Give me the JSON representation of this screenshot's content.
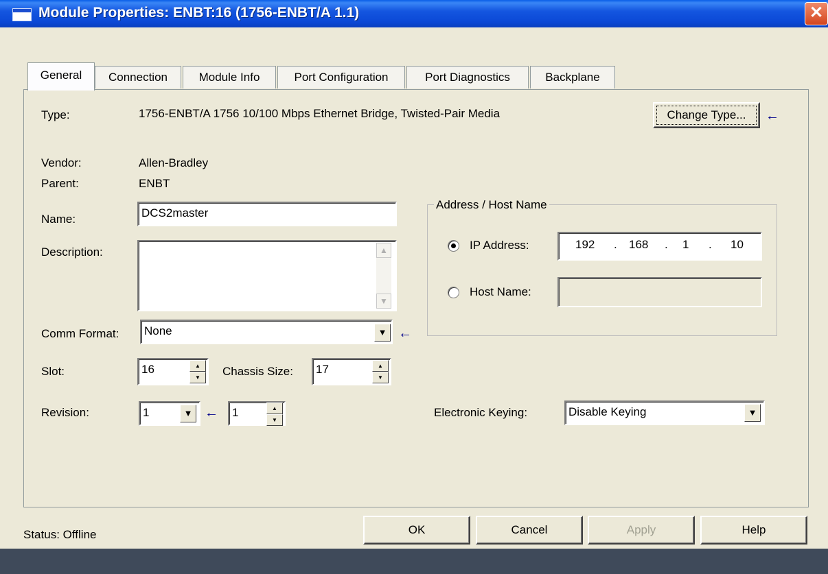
{
  "window": {
    "title": "Module Properties: ENBT:16 (1756-ENBT/A 1.1)",
    "close_glyph": "✕"
  },
  "tabs": [
    "General",
    "Connection",
    "Module Info",
    "Port Configuration",
    "Port Diagnostics",
    "Backplane"
  ],
  "active_tab": "General",
  "general": {
    "type_label": "Type:",
    "type_value": "1756-ENBT/A 1756 10/100 Mbps Ethernet Bridge, Twisted-Pair Media",
    "change_type_label": "Change Type...",
    "vendor_label": "Vendor:",
    "vendor_value": "Allen-Bradley",
    "parent_label": "Parent:",
    "parent_value": "ENBT",
    "name_label": "Name:",
    "name_value": "DCS2master",
    "description_label": "Description:",
    "description_value": "",
    "comm_format_label": "Comm Format:",
    "comm_format_value": "None",
    "slot_label": "Slot:",
    "slot_value": "16",
    "chassis_size_label": "Chassis Size:",
    "chassis_size_value": "17",
    "revision_label": "Revision:",
    "revision_major": "1",
    "revision_minor": "1",
    "address_group_label": "Address / Host Name",
    "ip_address_label": "IP Address:",
    "ip_octets": [
      "192",
      "168",
      "1",
      "10"
    ],
    "ip_address_selected": true,
    "host_name_label": "Host Name:",
    "host_name_value": "",
    "electronic_keying_label": "Electronic Keying:",
    "electronic_keying_value": "Disable Keying"
  },
  "status": {
    "label": "Status:",
    "value": "Offline"
  },
  "buttons": {
    "ok": "OK",
    "cancel": "Cancel",
    "apply": "Apply",
    "help": "Help"
  },
  "icons": {
    "indicator_arrow": "←",
    "dropdown_arrow": "▼",
    "spin_up": "▲",
    "spin_down": "▼",
    "scroll_up": "▲",
    "scroll_down": "▼"
  },
  "colors": {
    "title_bar": "#0b48d6",
    "dialog_background": "#ece9d8",
    "indicator_arrow": "#00008b",
    "close_button": "#d4461e"
  }
}
